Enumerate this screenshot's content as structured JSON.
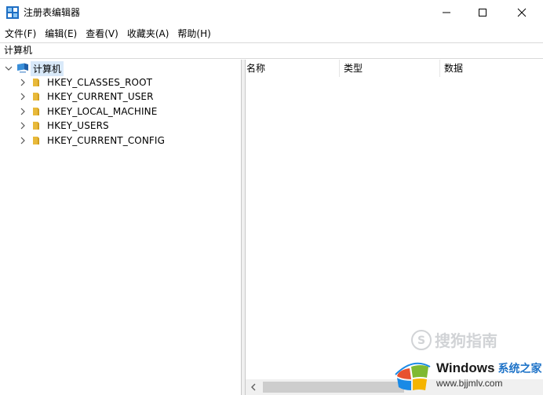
{
  "window": {
    "title": "注册表编辑器",
    "icon": "regedit-icon"
  },
  "menu": [
    {
      "label": "文件(F)"
    },
    {
      "label": "编辑(E)"
    },
    {
      "label": "查看(V)"
    },
    {
      "label": "收藏夹(A)"
    },
    {
      "label": "帮助(H)"
    }
  ],
  "address": "计算机",
  "tree": {
    "root": {
      "label": "计算机",
      "icon": "computer-icon",
      "expanded": true
    },
    "children": [
      {
        "label": "HKEY_CLASSES_ROOT",
        "icon": "folder-icon"
      },
      {
        "label": "HKEY_CURRENT_USER",
        "icon": "folder-icon"
      },
      {
        "label": "HKEY_LOCAL_MACHINE",
        "icon": "folder-icon"
      },
      {
        "label": "HKEY_USERS",
        "icon": "folder-icon"
      },
      {
        "label": "HKEY_CURRENT_CONFIG",
        "icon": "folder-icon"
      }
    ]
  },
  "list": {
    "columns": [
      "名称",
      "类型",
      "数据"
    ]
  },
  "watermarks": {
    "sogou": "搜狗指南",
    "windows_brand": "Windows",
    "windows_zh": "系统之家",
    "windows_url": "www.bjjmlv.com"
  },
  "colors": {
    "selection": "#d9e9f9",
    "folder": "#e8b93a",
    "border": "#d9d9d9"
  }
}
